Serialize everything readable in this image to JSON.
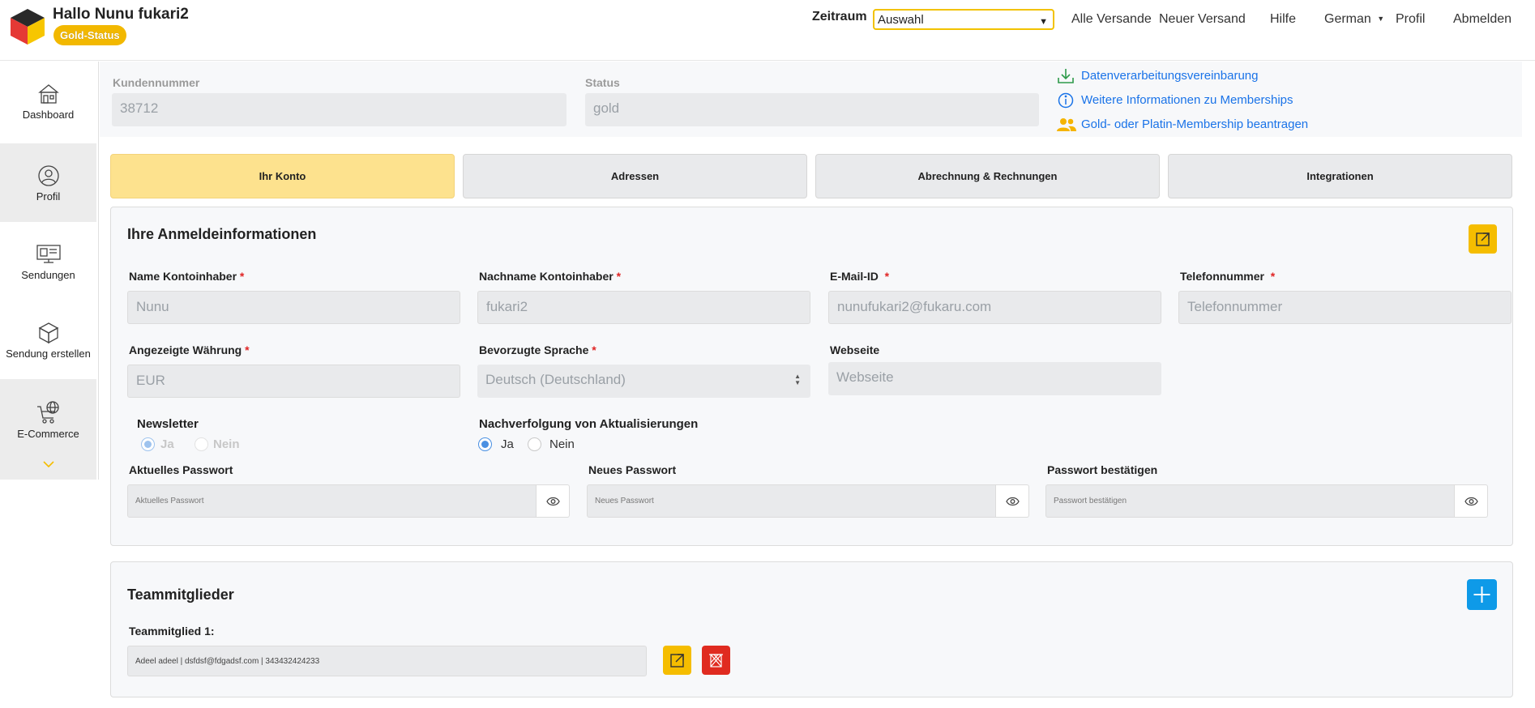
{
  "header": {
    "greeting": "Hallo Nunu fukari2",
    "badge": "Gold-Status",
    "zeitraum_label": "Zeitraum",
    "zeitraum_value": "Auswahl",
    "nav": [
      "Alle Versande",
      "Neuer Versand",
      "Hilfe",
      "German",
      "Profil",
      "Abmelden"
    ]
  },
  "sidebar": {
    "items": [
      {
        "label": "Dashboard",
        "icon": "house-icon"
      },
      {
        "label": "Profil",
        "icon": "user-circle-icon"
      },
      {
        "label": "Sendungen",
        "icon": "monitor-icon"
      },
      {
        "label": "Sendung erstellen",
        "icon": "box-icon"
      },
      {
        "label": "E-Commerce",
        "icon": "cart-globe-icon"
      }
    ]
  },
  "info": {
    "kundennummer_label": "Kundennummer",
    "kundennummer_value": "38712",
    "status_label": "Status",
    "status_value": "gold",
    "links": [
      "Datenverarbeitungsvereinbarung",
      "Weitere Informationen zu Memberships",
      "Gold- oder Platin-Membership beantragen"
    ]
  },
  "tabs": [
    "Ihr Konto",
    "Adressen",
    "Abrechnung & Rechnungen",
    "Integrationen"
  ],
  "account": {
    "title": "Ihre Anmeldeinformationen",
    "name_label": "Name Kontoinhaber",
    "name_value": "Nunu",
    "lastname_label": "Nachname Kontoinhaber",
    "lastname_value": "fukari2",
    "email_label": "E-Mail-ID",
    "email_value": "nunufukari2@fukaru.com",
    "phone_label": "Telefonnummer",
    "phone_placeholder": "Telefonnummer",
    "currency_label": "Angezeigte Währung",
    "currency_value": "EUR",
    "language_label": "Bevorzugte Sprache",
    "language_value": "Deutsch (Deutschland)",
    "website_label": "Webseite",
    "website_placeholder": "Webseite",
    "newsletter_label": "Newsletter",
    "tracking_label": "Nachverfolgung von Aktualisierungen",
    "yes": "Ja",
    "no": "Nein",
    "current_pw_label": "Aktuelles Passwort",
    "current_pw_placeholder": "Aktuelles Passwort",
    "new_pw_label": "Neues Passwort",
    "new_pw_placeholder": "Neues Passwort",
    "confirm_pw_label": "Passwort bestätigen",
    "confirm_pw_placeholder": "Passwort bestätigen",
    "required_mark": "*"
  },
  "team": {
    "title": "Teammitglieder",
    "member_label": "Teammitglied 1:",
    "member_value": "Adeel adeel | dsfdsf@fdgadsf.com | 343432424233"
  },
  "colors": {
    "accent_yellow": "#f5bd00",
    "active_tab": "#fde28e",
    "link_blue": "#1a73e8",
    "add_blue": "#0e9ae8",
    "delete_red": "#e02b20",
    "required_red": "#e02424"
  }
}
